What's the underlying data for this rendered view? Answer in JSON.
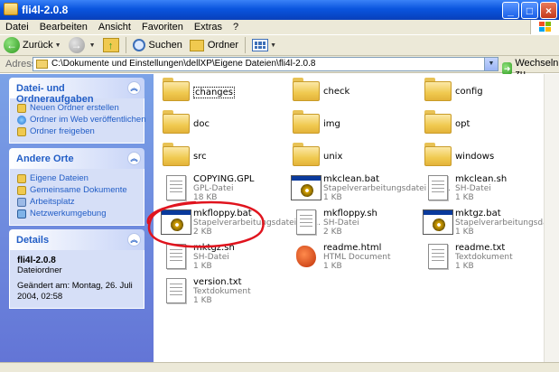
{
  "window": {
    "title": "fli4l-2.0.8"
  },
  "menu": [
    "Datei",
    "Bearbeiten",
    "Ansicht",
    "Favoriten",
    "Extras",
    "?"
  ],
  "toolbar": {
    "back": "Zurück",
    "search": "Suchen",
    "folders": "Ordner"
  },
  "address": {
    "label": "Adresse",
    "path": "C:\\Dokumente und Einstellungen\\dellXP\\Eigene Dateien\\fli4l-2.0.8",
    "go": "Wechseln zu"
  },
  "tasks_panel": {
    "title": "Datei- und Ordneraufgaben",
    "items": [
      "Neuen Ordner erstellen",
      "Ordner im Web veröffentlichen",
      "Ordner freigeben"
    ]
  },
  "places_panel": {
    "title": "Andere Orte",
    "items": [
      "Eigene Dateien",
      "Gemeinsame Dokumente",
      "Arbeitsplatz",
      "Netzwerkumgebung"
    ]
  },
  "details_panel": {
    "title": "Details",
    "name": "fli4l-2.0.8",
    "type": "Dateiordner",
    "changed": "Geändert am: Montag, 26. Juli 2004, 02:58"
  },
  "folders": [
    "changes",
    "check",
    "config",
    "doc",
    "img",
    "opt",
    "src",
    "unix",
    "windows"
  ],
  "files": [
    {
      "name": "COPYING.GPL",
      "type": "GPL-Datei",
      "size": "18 KB",
      "icon": "text-file-icon"
    },
    {
      "name": "mkclean.bat",
      "type": "Stapelverarbeitungsdatei für ...",
      "size": "1 KB",
      "icon": "batch-file-icon"
    },
    {
      "name": "mkclean.sh",
      "type": "SH-Datei",
      "size": "1 KB",
      "icon": "text-file-icon"
    },
    {
      "name": "mkfloppy.bat",
      "type": "Stapelverarbeitungsdatei für ...",
      "size": "2 KB",
      "icon": "batch-file-icon"
    },
    {
      "name": "mkfloppy.sh",
      "type": "SH-Datei",
      "size": "2 KB",
      "icon": "text-file-icon"
    },
    {
      "name": "mktgz.bat",
      "type": "Stapelverarbeitungsdatei für ...",
      "size": "1 KB",
      "icon": "batch-file-icon"
    },
    {
      "name": "mktgz.sh",
      "type": "SH-Datei",
      "size": "1 KB",
      "icon": "text-file-icon"
    },
    {
      "name": "readme.html",
      "type": "HTML Document",
      "size": "1 KB",
      "icon": "html-file-icon"
    },
    {
      "name": "readme.txt",
      "type": "Textdokument",
      "size": "1 KB",
      "icon": "text-file-icon"
    },
    {
      "name": "version.txt",
      "type": "Textdokument",
      "size": "1 KB",
      "icon": "text-file-icon"
    }
  ],
  "colors": {
    "title_bar": "#0a55de",
    "task_pane": "#7ba2e7",
    "link": "#215dc6",
    "highlight_circle": "#e0141e"
  }
}
